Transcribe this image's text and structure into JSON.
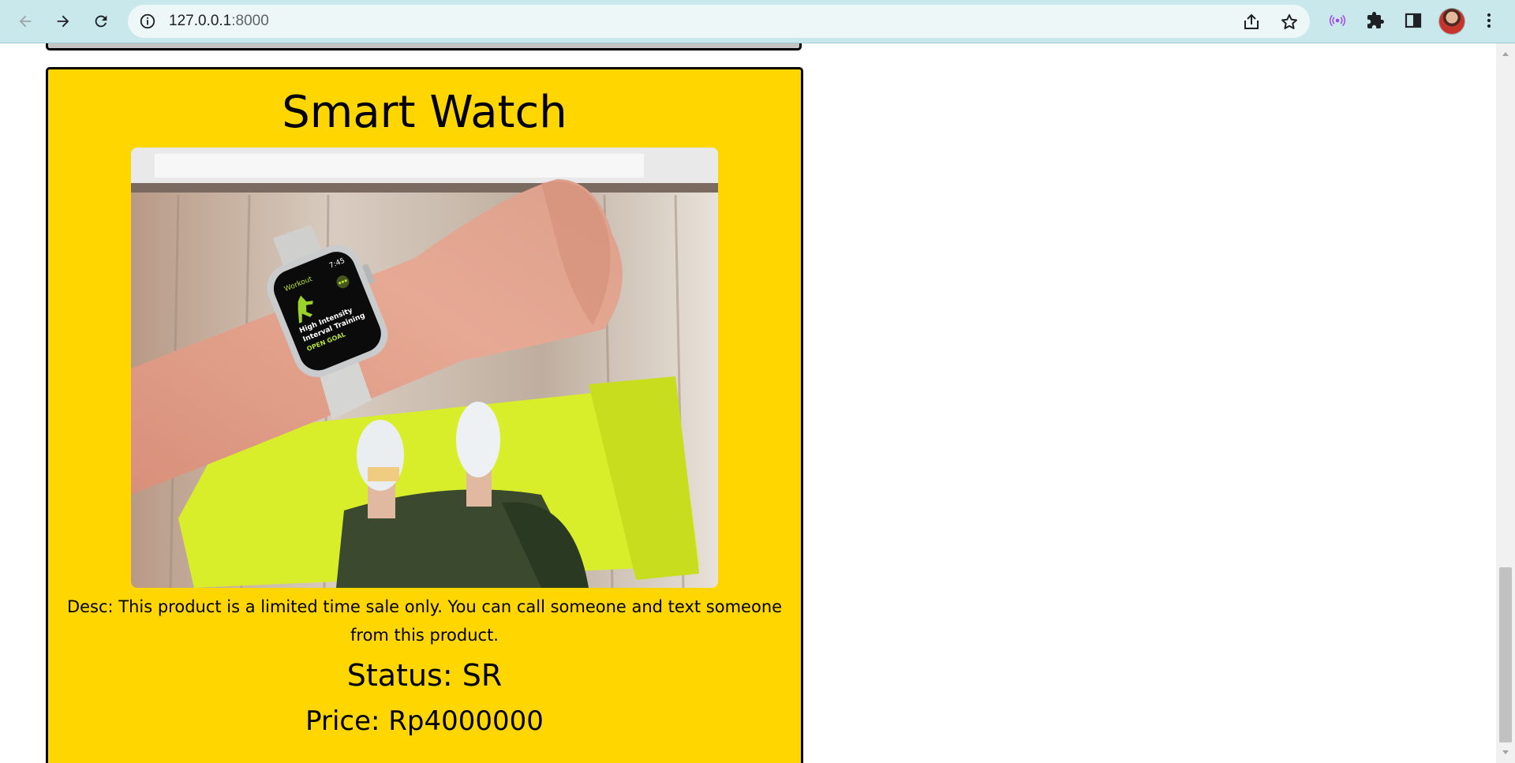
{
  "browser": {
    "url_host": "127.0.0.1",
    "url_port": ":8000"
  },
  "product": {
    "title": "Smart Watch",
    "image_alt": "Wrist wearing smart watch showing workout app over a yellow-green mat",
    "watch_screen": {
      "app": "Workout",
      "time": "7:45",
      "line1": "High Intensity",
      "line2": "Interval Training",
      "goal": "OPEN GOAL"
    },
    "description": "Desc: This product is a limited time sale only. You can call someone and text someone from this product.",
    "status": "Status: SR",
    "price": "Price: Rp4000000"
  },
  "colors": {
    "card_background": "#ffd600",
    "chrome_background": "#c9e8ec"
  }
}
